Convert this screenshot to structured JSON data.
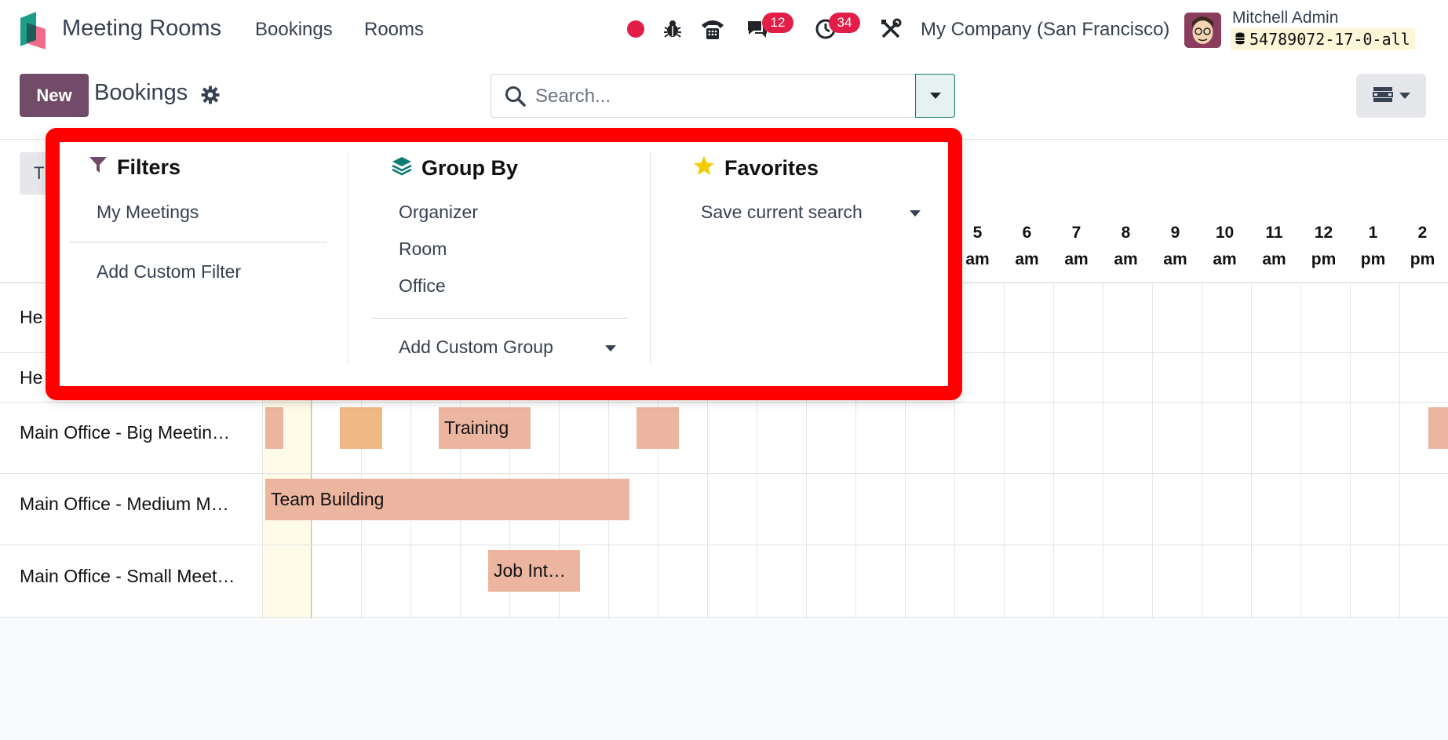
{
  "app": {
    "name": "Meeting Rooms",
    "menu": [
      "Bookings",
      "Rooms"
    ]
  },
  "systray": {
    "messages_count": "12",
    "activities_count": "34",
    "company": "My Company (San Francisco)",
    "user_name": "Mitchell Admin",
    "database": "54789072-17-0-all"
  },
  "control": {
    "new_label": "New",
    "breadcrumb": "Bookings",
    "search_placeholder": "Search...",
    "today_label": "T"
  },
  "search_panel": {
    "filters": {
      "title": "Filters",
      "items": [
        "My Meetings"
      ],
      "add_custom": "Add Custom Filter"
    },
    "group_by": {
      "title": "Group By",
      "items": [
        "Organizer",
        "Room",
        "Office"
      ],
      "add_custom": "Add Custom Group"
    },
    "favorites": {
      "title": "Favorites",
      "save_current": "Save current search"
    }
  },
  "gantt": {
    "hours": [
      {
        "n": "5",
        "p": "am"
      },
      {
        "n": "6",
        "p": "am"
      },
      {
        "n": "7",
        "p": "am"
      },
      {
        "n": "8",
        "p": "am"
      },
      {
        "n": "9",
        "p": "am"
      },
      {
        "n": "10",
        "p": "am"
      },
      {
        "n": "11",
        "p": "am"
      },
      {
        "n": "12",
        "p": "pm"
      },
      {
        "n": "1",
        "p": "pm"
      },
      {
        "n": "2",
        "p": "pm"
      }
    ],
    "rows": [
      {
        "label": "He"
      },
      {
        "label": "He"
      },
      {
        "label": "Main Office - Big Meetin…"
      },
      {
        "label": "Main Office - Medium M…"
      },
      {
        "label": "Main Office - Small Meet…"
      }
    ],
    "events": [
      {
        "name": "Training"
      },
      {
        "name": "Team Building"
      },
      {
        "name": "Job Int…"
      }
    ]
  },
  "colors": {
    "brand": "#714b67",
    "highlight_frame": "#ff0000",
    "event_fill": "#ebb59f",
    "badge": "#e11d48"
  }
}
